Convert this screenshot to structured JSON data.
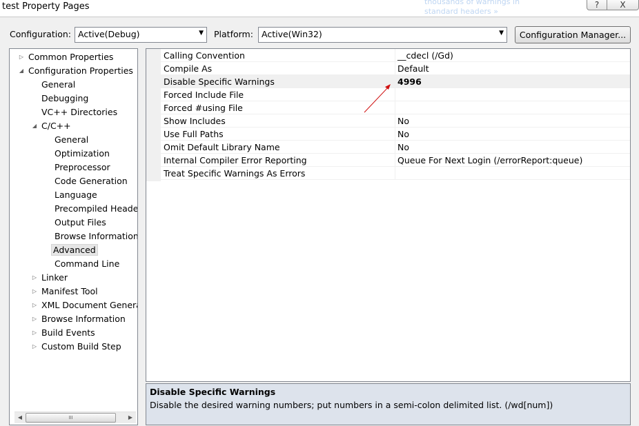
{
  "window": {
    "title": "test Property Pages",
    "background_text_1": "thousands of warnings in",
    "background_text_2": "standard headers  »",
    "help_glyph": "?",
    "close_glyph": "X"
  },
  "toolbar": {
    "configuration_label": "Configuration:",
    "configuration_value": "Active(Debug)",
    "platform_label": "Platform:",
    "platform_value": "Active(Win32)",
    "configuration_manager_label": "Configuration Manager..."
  },
  "tree": {
    "items": [
      {
        "label": "Common Properties",
        "toggle": "▷"
      },
      {
        "label": "Configuration Properties",
        "toggle": "◢"
      },
      {
        "label": "General",
        "toggle": ""
      },
      {
        "label": "Debugging",
        "toggle": ""
      },
      {
        "label": "VC++ Directories",
        "toggle": ""
      },
      {
        "label": "C/C++",
        "toggle": "◢"
      },
      {
        "label": "General",
        "toggle": ""
      },
      {
        "label": "Optimization",
        "toggle": ""
      },
      {
        "label": "Preprocessor",
        "toggle": ""
      },
      {
        "label": "Code Generation",
        "toggle": ""
      },
      {
        "label": "Language",
        "toggle": ""
      },
      {
        "label": "Precompiled Headers",
        "toggle": ""
      },
      {
        "label": "Output Files",
        "toggle": ""
      },
      {
        "label": "Browse Information",
        "toggle": ""
      },
      {
        "label": "Advanced",
        "toggle": ""
      },
      {
        "label": "Command Line",
        "toggle": ""
      },
      {
        "label": "Linker",
        "toggle": "▷"
      },
      {
        "label": "Manifest Tool",
        "toggle": "▷"
      },
      {
        "label": "XML Document Generator",
        "toggle": "▷"
      },
      {
        "label": "Browse Information",
        "toggle": "▷"
      },
      {
        "label": "Build Events",
        "toggle": "▷"
      },
      {
        "label": "Custom Build Step",
        "toggle": "▷"
      }
    ],
    "selected_label": "Advanced",
    "scroll_grip": "III"
  },
  "grid": {
    "rows": [
      {
        "name": "Calling Convention",
        "value": "__cdecl (/Gd)"
      },
      {
        "name": "Compile As",
        "value": "Default"
      },
      {
        "name": "Disable Specific Warnings",
        "value": "4996"
      },
      {
        "name": "Forced Include File",
        "value": ""
      },
      {
        "name": "Forced #using File",
        "value": ""
      },
      {
        "name": "Show Includes",
        "value": "No"
      },
      {
        "name": "Use Full Paths",
        "value": "No"
      },
      {
        "name": "Omit Default Library Name",
        "value": "No"
      },
      {
        "name": "Internal Compiler Error Reporting",
        "value": "Queue For Next Login (/errorReport:queue)"
      },
      {
        "name": "Treat Specific Warnings As Errors",
        "value": ""
      }
    ],
    "selected_row": "Disable Specific Warnings"
  },
  "description": {
    "title": "Disable Specific Warnings",
    "text": "Disable the desired warning numbers; put numbers in a semi-colon delimited list.     (/wd[num])"
  },
  "colors": {
    "annotation_arrow": "#d01010",
    "description_bg": "#dde3ec"
  }
}
